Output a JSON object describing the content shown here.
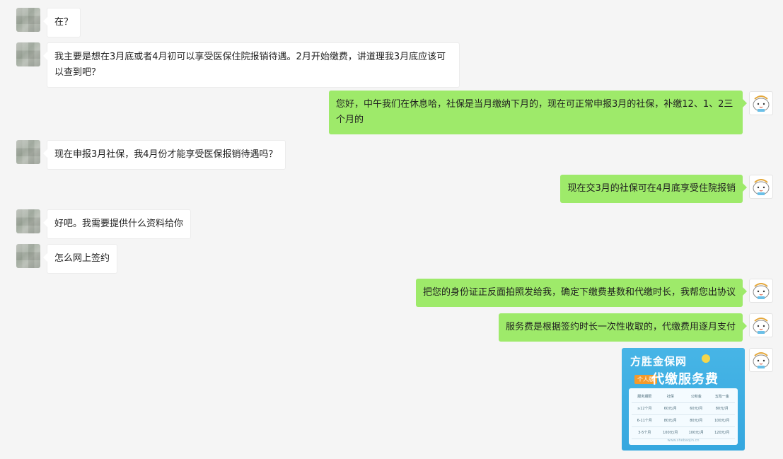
{
  "messages": [
    {
      "side": "left",
      "text": "在？"
    },
    {
      "side": "left",
      "text": "我主要是想在3月底或者4月初可以享受医保住院报销待遇。2月开始缴费，讲道理我3月底应该可以查到吧？"
    },
    {
      "side": "right",
      "text": "您好，中午我们在休息哈，社保是当月缴纳下月的，现在可正常申报3月的社保，补缴12、1、2三个月的"
    },
    {
      "side": "left",
      "text": "现在申报3月社保，我4月份才能享受医保报销待遇吗？"
    },
    {
      "side": "right",
      "text": "现在交3月的社保可在4月底享受住院报销"
    },
    {
      "side": "left",
      "text": "好吧。我需要提供什么资料给你"
    },
    {
      "side": "left",
      "text": "怎么网上签约"
    },
    {
      "side": "right",
      "text": "把您的身份证正反面拍照发给我，确定下缴费基数和代缴时长，我帮您出协议"
    },
    {
      "side": "right",
      "text": "服务费是根据签约时长一次性收取的，代缴费用逐月支付"
    }
  ],
  "image_message": {
    "title_line1": "方胜金保网",
    "title_line2": "代缴服务费",
    "tag": "个人版",
    "table_header": [
      "服务期限",
      "社保",
      "公积金",
      "五险一金"
    ],
    "table_rows": [
      [
        "≥12个月",
        "60元/月",
        "60元/月",
        "80元/月"
      ],
      [
        "6-11个月",
        "80元/月",
        "80元/月",
        "100元/月"
      ],
      [
        "3-5个月",
        "100元/月",
        "100元/月",
        "120元/月"
      ]
    ],
    "site": "www.shebaojin.cn"
  }
}
